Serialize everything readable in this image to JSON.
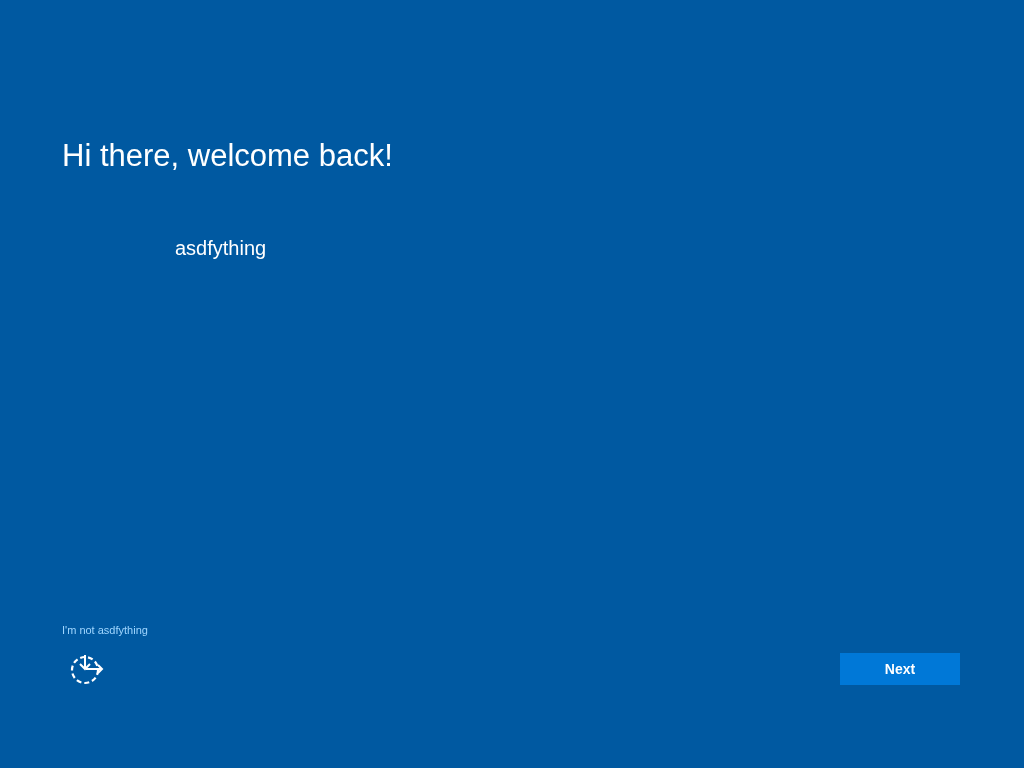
{
  "heading": "Hi there, welcome back!",
  "account": {
    "name": "asdfything"
  },
  "switch_link": "I'm not asdfything",
  "next_button": "Next"
}
